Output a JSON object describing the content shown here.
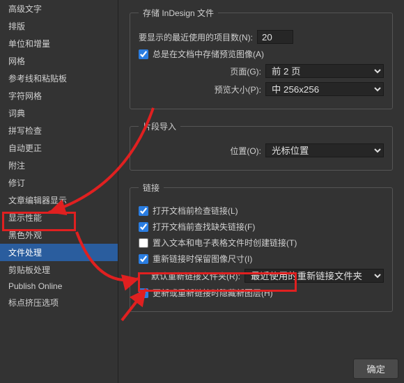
{
  "sidebar": {
    "items": [
      {
        "label": "高级文字"
      },
      {
        "label": "排版"
      },
      {
        "label": "单位和增量"
      },
      {
        "label": "网格"
      },
      {
        "label": "参考线和粘贴板"
      },
      {
        "label": "字符网格"
      },
      {
        "label": "词典"
      },
      {
        "label": "拼写检查"
      },
      {
        "label": "自动更正"
      },
      {
        "label": "附注"
      },
      {
        "label": "修订"
      },
      {
        "label": "文章编辑器显示"
      },
      {
        "label": "显示性能"
      },
      {
        "label": "黑色外观"
      },
      {
        "label": "文件处理"
      },
      {
        "label": "剪贴板处理"
      },
      {
        "label": "Publish Online"
      },
      {
        "label": "标点挤压选项"
      }
    ],
    "selected_index": 14
  },
  "save_section": {
    "legend": "存储 InDesign 文件",
    "recent_label": "要显示的最近使用的项目数(N):",
    "recent_value": "20",
    "always_save_preview_label": "总是在文档中存储预览图像(A)",
    "always_save_preview_checked": true,
    "pages_label": "页面(G):",
    "pages_value": "前 2 页",
    "preview_size_label": "预览大小(P):",
    "preview_size_value": "中 256x256"
  },
  "fragment_section": {
    "legend": "片段导入",
    "position_label": "位置(O):",
    "position_value": "光标位置"
  },
  "links_section": {
    "legend": "链接",
    "check_links_label": "打开文档前检查链接(L)",
    "check_links_checked": true,
    "find_missing_label": "打开文档前查找缺失链接(F)",
    "find_missing_checked": true,
    "create_links_label": "置入文本和电子表格文件时创建链接(T)",
    "create_links_checked": false,
    "preserve_dims_label": "重新链接时保留图像尺寸(I)",
    "preserve_dims_checked": true,
    "default_relink_label": "默认重新链接文件夹(R):",
    "default_relink_value": "最近使用的重新链接文件夹",
    "hide_layers_label": "更新或重新链接时隐藏新图层(H)",
    "hide_layers_checked": true
  },
  "footer": {
    "ok_label": "确定"
  }
}
